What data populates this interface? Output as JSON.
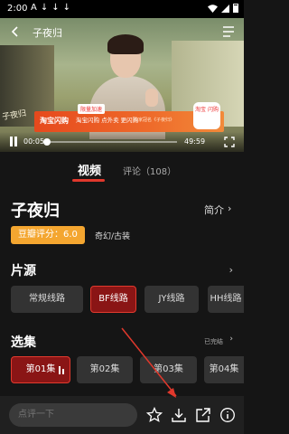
{
  "status_bar": {
    "time": "2:00",
    "notif_icons": [
      "A",
      "↓",
      "↓",
      "↓"
    ]
  },
  "player": {
    "title": "子夜归",
    "watermark": "子夜归",
    "banner": {
      "brand": "淘宝闪购",
      "pill": "限量加速",
      "slogan": "淘宝闪购 点外卖 更闪购",
      "slogan2": "独家冠名《子夜归》",
      "logo": "淘宝\n闪购"
    },
    "current_time": "00:05",
    "duration": "49:59",
    "progress_fraction": 0.0017
  },
  "tabs": {
    "video": "视频",
    "comments": "评论（108）"
  },
  "show": {
    "title": "子夜归",
    "intro": "简介",
    "rating": "豆瓣评分：6.0",
    "genre": "奇幻/古装"
  },
  "sources": {
    "title": "片源",
    "items": [
      {
        "label": "常规线路",
        "active": false
      },
      {
        "label": "BF线路",
        "active": true
      },
      {
        "label": "JY线路",
        "active": false
      },
      {
        "label": "HH线路",
        "active": false
      }
    ]
  },
  "episodes": {
    "title": "选集",
    "status": "已完结",
    "items": [
      {
        "label": "第01集",
        "active": true
      },
      {
        "label": "第02集",
        "active": false
      },
      {
        "label": "第03集",
        "active": false
      },
      {
        "label": "第04集",
        "active": false
      }
    ]
  },
  "bottom_bar": {
    "comment_placeholder": "点评一下",
    "icons": [
      "star-icon",
      "download-icon",
      "share-icon",
      "info-icon"
    ]
  },
  "colors": {
    "accent": "#e0382c",
    "rating_bg": "#f4a630",
    "background": "#151515"
  }
}
